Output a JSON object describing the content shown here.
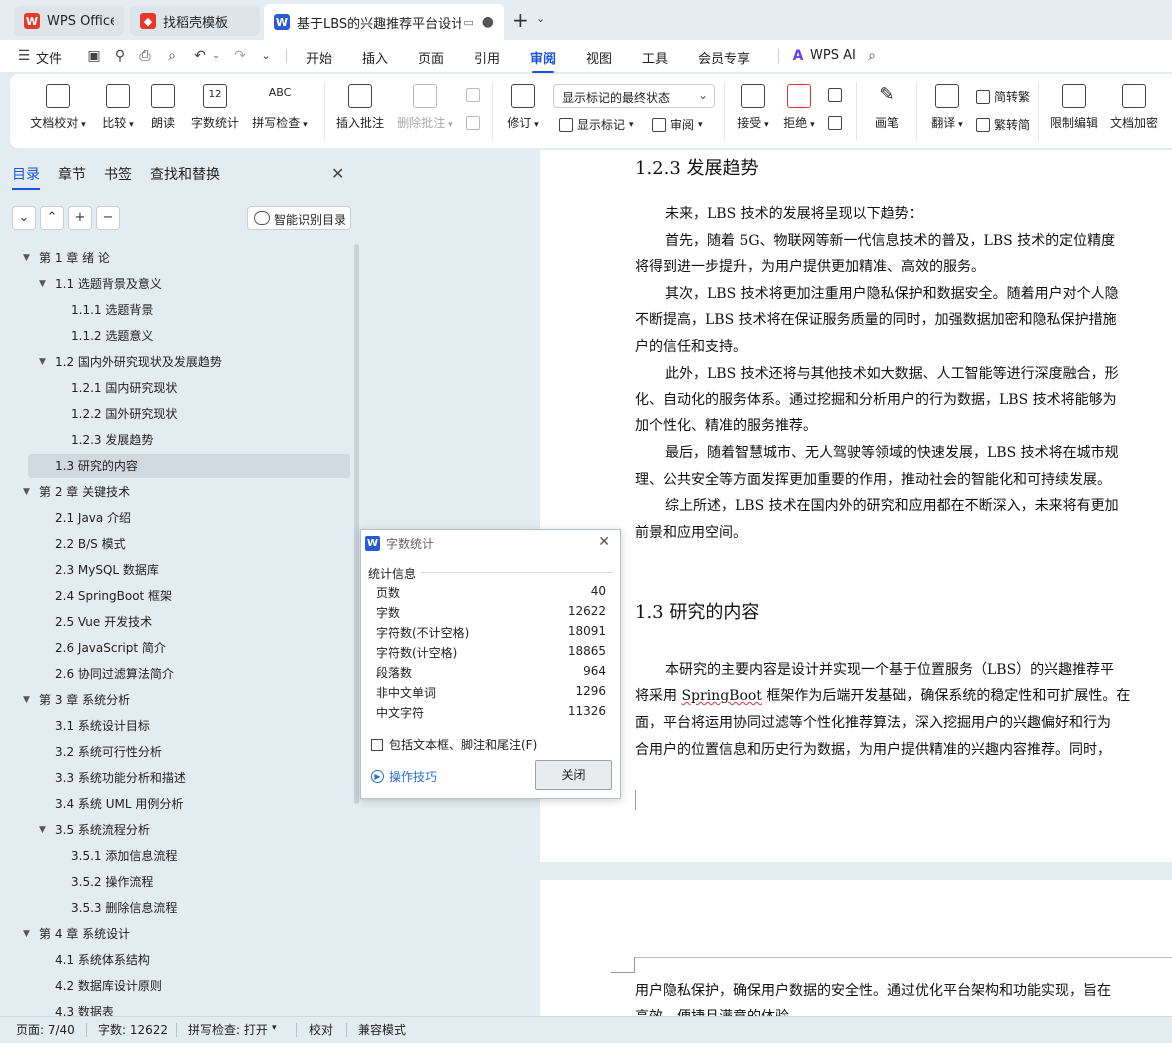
{
  "tabs": [
    {
      "label": "WPS Office",
      "color": "#e8382c"
    },
    {
      "label": "找稻壳模板",
      "color": "#e8382c"
    },
    {
      "label": "基于LBS的兴趣推荐平台设计与",
      "color": "#2a5bd7"
    }
  ],
  "menu": {
    "file": "文件",
    "items": [
      "开始",
      "插入",
      "页面",
      "引用",
      "审阅",
      "视图",
      "工具",
      "会员专享"
    ],
    "active": "审阅",
    "ai": "WPS AI"
  },
  "ribbon": {
    "proofread": "文档校对",
    "compare": "比较",
    "read_aloud": "朗读",
    "word_count": "字数统计",
    "spell_check": "拼写检查",
    "insert_comment": "插入批注",
    "delete_comment": "删除批注",
    "revise": "修订",
    "markup_select": "显示标记的最终状态",
    "show_markup": "显示标记",
    "review": "审阅",
    "accept": "接受",
    "reject": "拒绝",
    "ink": "画笔",
    "translate": "翻译",
    "to_traditional": "简转繁",
    "to_simplified": "繁转简",
    "restrict_edit": "限制编辑",
    "encrypt": "文档加密"
  },
  "nav": {
    "tabs": [
      "目录",
      "章节",
      "书签",
      "查找和替换"
    ],
    "smart_button": "智能识别目录",
    "toc": [
      {
        "label": "第 1 章  绪  论",
        "level": 0,
        "expanded": true
      },
      {
        "label": "1.1 选题背景及意义",
        "level": 1,
        "expanded": true
      },
      {
        "label": "1.1.1  选题背景",
        "level": 2
      },
      {
        "label": "1.1.2  选题意义",
        "level": 2
      },
      {
        "label": "1.2 国内外研究现状及发展趋势",
        "level": 1,
        "expanded": true
      },
      {
        "label": "1.2.1  国内研究现状",
        "level": 2
      },
      {
        "label": "1.2.2  国外研究现状",
        "level": 2
      },
      {
        "label": "1.2.3  发展趋势",
        "level": 2
      },
      {
        "label": "1.3  研究的内容",
        "level": 1,
        "selected": true
      },
      {
        "label": "第 2 章  关键技术",
        "level": 0,
        "expanded": true
      },
      {
        "label": "2.1 Java 介绍",
        "level": 1
      },
      {
        "label": "2.2 B/S 模式",
        "level": 1
      },
      {
        "label": "2.3 MySQL 数据库",
        "level": 1
      },
      {
        "label": "2.4 SpringBoot 框架",
        "level": 1
      },
      {
        "label": "2.5 Vue 开发技术",
        "level": 1
      },
      {
        "label": "2.6 JavaScript 简介",
        "level": 1
      },
      {
        "label": "2.6  协同过滤算法简介",
        "level": 1
      },
      {
        "label": "第 3 章  系统分析",
        "level": 0,
        "expanded": true
      },
      {
        "label": "3.1  系统设计目标",
        "level": 1
      },
      {
        "label": "3.2  系统可行性分析",
        "level": 1
      },
      {
        "label": "3.3  系统功能分析和描述",
        "level": 1
      },
      {
        "label": "3.4  系统 UML 用例分析",
        "level": 1
      },
      {
        "label": "3.5 系统流程分析",
        "level": 1,
        "expanded": true
      },
      {
        "label": "3.5.1 添加信息流程",
        "level": 2
      },
      {
        "label": "3.5.2 操作流程",
        "level": 2
      },
      {
        "label": "3.5.3 删除信息流程",
        "level": 2
      },
      {
        "label": "第 4 章  系统设计",
        "level": 0,
        "expanded": true
      },
      {
        "label": "4.1  系统体系结构",
        "level": 1
      },
      {
        "label": "4.2  数据库设计原则",
        "level": 1
      },
      {
        "label": "4.3  数据表",
        "level": 1
      }
    ]
  },
  "document": {
    "heading_1": "1.2.3  发展趋势",
    "p1": "未来，LBS 技术的发展将呈现以下趋势：",
    "p2a": "首先，随着 5G、物联网等新一代信息技术的普及，LBS 技术的定位精度",
    "p2b": "将得到进一步提升，为用户提供更加精准、高效的服务。",
    "p3a": "其次，LBS 技术将更加注重用户隐私保护和数据安全。随着用户对个人隐",
    "p3b": "不断提高，LBS 技术将在保证服务质量的同时，加强数据加密和隐私保护措施",
    "p3c": "户的信任和支持。",
    "p4a": "此外，LBS 技术还将与其他技术如大数据、人工智能等进行深度融合，形",
    "p4b": "化、自动化的服务体系。通过挖掘和分析用户的行为数据，LBS 技术将能够为",
    "p4c": "加个性化、精准的服务推荐。",
    "p5a": "最后，随着智慧城市、无人驾驶等领域的快速发展，LBS 技术将在城市规",
    "p5b": "理、公共安全等方面发挥更加重要的作用，推动社会的智能化和可持续发展。",
    "p6a": "综上所述，LBS 技术在国内外的研究和应用都在不断深入，未来将有更加",
    "p6b": "前景和应用空间。",
    "heading_2": "1.3  研究的内容",
    "p7a": "本研究的主要内容是设计并实现一个基于位置服务（LBS）的兴趣推荐平",
    "p7b_pre": "将采用 ",
    "p7b_word": "SpringBoot",
    "p7b_post": " 框架作为后端开发基础，确保系统的稳定性和可扩展性。在",
    "p7c": "面，平台将运用协同过滤等个性化推荐算法，深入挖掘用户的兴趣偏好和行为",
    "p7d": "合用户的位置信息和历史行为数据，为用户提供精准的兴趣内容推荐。同时，",
    "p8a": "用户隐私保护，确保用户数据的安全性。通过优化平台架构和功能实现，旨在",
    "p8b": "高效、便捷且满意的体验。"
  },
  "dialog": {
    "title": "字数统计",
    "section": "统计信息",
    "stats": [
      {
        "label": "页数",
        "value": "40"
      },
      {
        "label": "字数",
        "value": "12622"
      },
      {
        "label": "字符数(不计空格)",
        "value": "18091"
      },
      {
        "label": "字符数(计空格)",
        "value": "18865"
      },
      {
        "label": "段落数",
        "value": "964"
      },
      {
        "label": "非中文单词",
        "value": "1296"
      },
      {
        "label": "中文字符",
        "value": "11326"
      }
    ],
    "checkbox": "包括文本框、脚注和尾注(F)",
    "tips": "操作技巧",
    "close": "关闭"
  },
  "status": {
    "page": "页面: 7/40",
    "words": "字数: 12622",
    "spell": "拼写检查: 打开",
    "proof": "校对",
    "compat": "兼容模式"
  },
  "colors": {
    "accent": "#1a53e0",
    "panel": "#e3ecf0"
  }
}
